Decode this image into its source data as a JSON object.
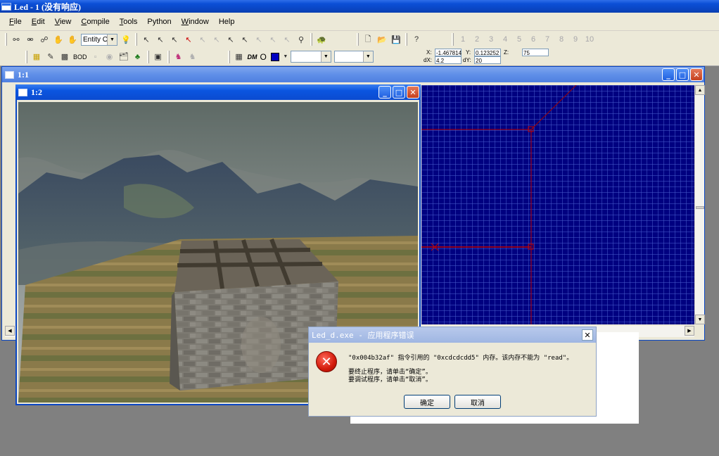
{
  "app": {
    "title": "Led - 1 (没有响应)"
  },
  "menu": [
    {
      "label": "File",
      "key": "F"
    },
    {
      "label": "Edit",
      "key": "E"
    },
    {
      "label": "View",
      "key": "V"
    },
    {
      "label": "Compile",
      "key": "C"
    },
    {
      "label": "Tools",
      "key": "T"
    },
    {
      "label": "Python",
      "key": ""
    },
    {
      "label": "Window",
      "key": "W"
    },
    {
      "label": "Help",
      "key": ""
    }
  ],
  "toolbar": {
    "entity_select": "Entity Ol",
    "bod_label": "BOD",
    "dm_label": "DM",
    "o_label": "O",
    "tab_numbers": [
      "1",
      "2",
      "3",
      "4",
      "5",
      "6",
      "7",
      "8",
      "9",
      "10"
    ],
    "dropdown_a": "",
    "dropdown_b": ""
  },
  "coords": {
    "x_label": "X:",
    "x": "-1.467814",
    "y_label": "Y:",
    "y": "0.123252",
    "z_label": "Z:",
    "z": "75",
    "dx_label": "dX:",
    "dx": "4.2",
    "dy_label": "dY:",
    "dy": "20"
  },
  "windows": {
    "grid_title": "1:1",
    "scene_title": "1:2"
  },
  "dialog": {
    "title": "Led_d.exe - 应用程序错误",
    "line1": "\"0x004b32af\" 指令引用的 \"0xcdcdcdd5\" 内存。该内存不能为 \"read\"。",
    "line2": "要终止程序，请单击“确定”。",
    "line3": "要调试程序，请单击“取消”。",
    "ok": "确定",
    "cancel": "取消"
  },
  "colors": {
    "grid_bg": "#000080",
    "grid_line": "#c00000",
    "titlebar": "#0a46c4"
  }
}
